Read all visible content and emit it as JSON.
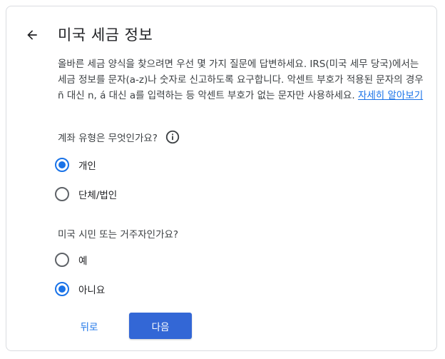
{
  "header": {
    "title": "미국 세금 정보",
    "back_icon": "arrow-left-icon"
  },
  "intro": {
    "text": "올바른 세금 양식을 찾으려면 우선 몇 가지 질문에 답변하세요. IRS(미국 세무 당국)에서는 세금 정보를 문자(a-z)나 숫자로 신고하도록 요구합니다. 악센트 부호가 적용된 문자의 경우 ñ 대신 n, á 대신 a를 입력하는 등 악센트 부호가 없는 문자만 사용하세요.",
    "link_label": "자세히 알아보기"
  },
  "question_account_type": {
    "label": "계좌 유형은 무엇인가요?",
    "info_icon": "info-icon",
    "options": [
      {
        "label": "개인",
        "selected": true
      },
      {
        "label": "단체/법인",
        "selected": false
      }
    ]
  },
  "question_us_citizen": {
    "label": "미국 시민 또는 거주자인가요?",
    "options": [
      {
        "label": "예",
        "selected": false
      },
      {
        "label": "아니요",
        "selected": true
      }
    ]
  },
  "footer": {
    "back_label": "뒤로",
    "next_label": "다음"
  },
  "colors": {
    "accent": "#1a73e8",
    "primary_button": "#3367d6",
    "border": "#dadce0"
  }
}
